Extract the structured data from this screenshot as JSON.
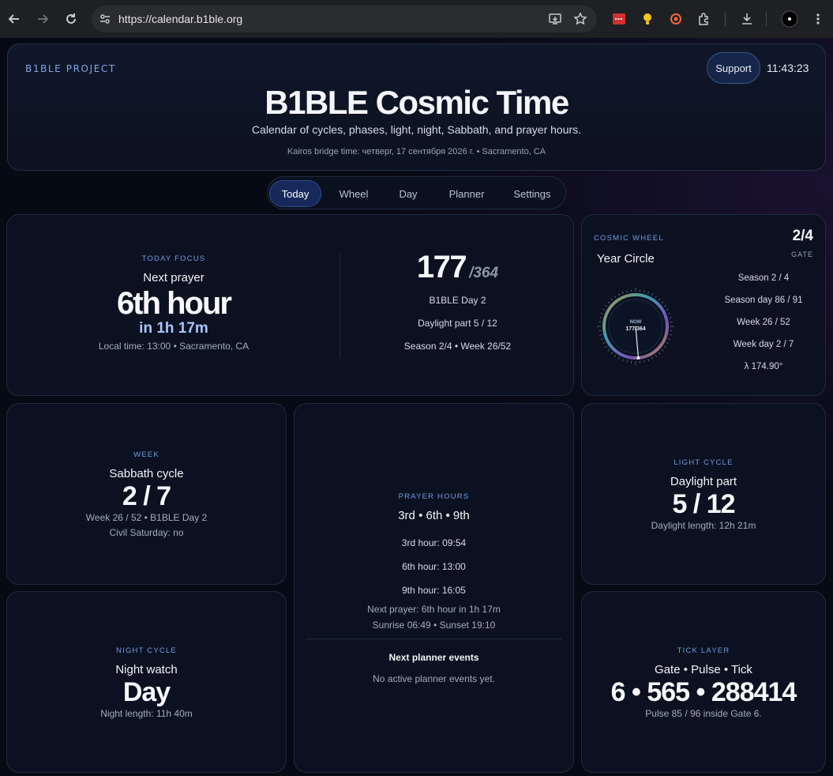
{
  "browser": {
    "url": "https://calendar.b1ble.org"
  },
  "header": {
    "brand": "B1BLE PROJECT",
    "support_label": "Support",
    "time": "11:43:23",
    "title": "B1BLE Cosmic Time",
    "subtitle": "Calendar of cycles, phases, light, night, Sabbath, and prayer hours.",
    "kairos": "Kairos bridge time: четверг, 17 сентября 2026 г. • Sacramento, CA"
  },
  "tabs": [
    "Today",
    "Wheel",
    "Day",
    "Planner",
    "Settings"
  ],
  "focus": {
    "label": "TODAY FOCUS",
    "title": "Next prayer",
    "hour": "6th hour",
    "countdown": "in 1h 17m",
    "local": "Local time: 13:00 • Sacramento, CA",
    "day_num": "177",
    "day_total": "/364",
    "bible_day": "B1BLE Day 2",
    "daylight": "Daylight part 5 / 12",
    "season_week": "Season 2/4 • Week 26/52"
  },
  "wheel": {
    "label": "COSMIC WHEEL",
    "title": "Year Circle",
    "gate_value": "2/4",
    "gate_label": "GATE",
    "now": "NOW",
    "now_value": "177/364",
    "rows": [
      "Season 2 / 4",
      "Season day 86 / 91",
      "Week 26 / 52",
      "Week day 2 / 7",
      "λ 174.90°"
    ],
    "progress": 0.486
  },
  "week": {
    "label": "WEEK",
    "title": "Sabbath cycle",
    "value": "2 / 7",
    "meta1": "Week 26 / 52 • B1BLE Day 2",
    "meta2": "Civil Saturday: no"
  },
  "prayer": {
    "label": "PRAYER HOURS",
    "title": "3rd • 6th • 9th",
    "rows": [
      "3rd hour: 09:54",
      "6th hour: 13:00",
      "9th hour: 16:05"
    ],
    "next": "Next prayer: 6th hour in 1h 17m",
    "sun": "Sunrise 06:49 • Sunset 19:10",
    "planner_title": "Next planner events",
    "planner_empty": "No active planner events yet."
  },
  "light": {
    "label": "LIGHT CYCLE",
    "title": "Daylight part",
    "value": "5 / 12",
    "meta": "Daylight length: 12h 21m"
  },
  "night": {
    "label": "NIGHT CYCLE",
    "title": "Night watch",
    "value": "Day",
    "meta": "Night length: 11h 40m"
  },
  "tick": {
    "label": "TICK LAYER",
    "title": "Gate • Pulse • Tick",
    "value": "6 • 565 • 288414",
    "meta": "Pulse 85 / 96 inside Gate 6."
  }
}
